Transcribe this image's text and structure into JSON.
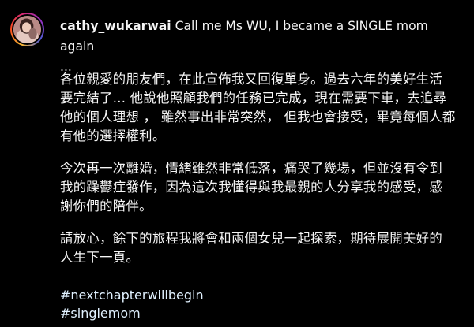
{
  "post": {
    "username": "cathy_wukarwai",
    "title_rest": " Call me Ms WU, I became a SINGLE mom again",
    "ellipsis": "...",
    "paragraph1": "各位親愛的朋友們，在此宣佈我又回復單身。過去六年的美好生活\n要完結了... 他說他照顧我們的任務已完成，現在需要下車，去追尋\n他的個人理想 ，  雖然事出非常突然， 但我也會接受，畢竟每個人都\n有他的選擇權利。",
    "paragraph2": "今次再一次離婚，情緒雖然非常低落，痛哭了幾場，但並沒有令到\n我的躁鬱症發作，因為這次我懂得與我最親的人分享我的感受，感\n謝你們的陪伴。",
    "paragraph3": "請放心，餘下的旅程我將會和兩個女兒一起探索，期待展開美好的\n人生下一頁。",
    "hashtags": [
      "#nextchapterwillbegin",
      "#singlemom"
    ]
  },
  "colors": {
    "background": "#000000",
    "text": "#f5f5f5",
    "hashtag": "#e0f1ff"
  }
}
